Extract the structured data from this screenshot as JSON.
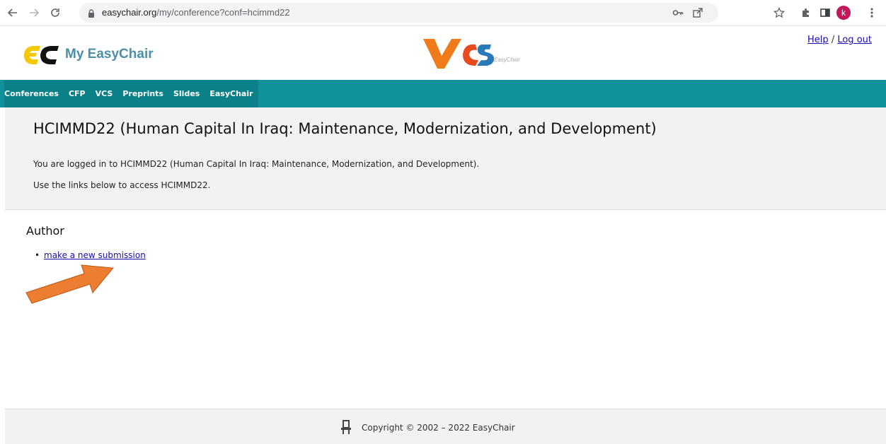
{
  "browser": {
    "url_domain": "easychair.org",
    "url_path": "/my/conference?conf=hcimmd22",
    "profile_initial": "k"
  },
  "header": {
    "brand": "My EasyChair",
    "vcs_tagline": "EasyChair",
    "help_label": "Help",
    "separator": "/",
    "logout_label": "Log out"
  },
  "menu": {
    "items": [
      {
        "label": "Conferences"
      },
      {
        "label": "CFP"
      },
      {
        "label": "VCS"
      },
      {
        "label": "Preprints"
      },
      {
        "label": "Slides"
      },
      {
        "label": "EasyChair"
      }
    ]
  },
  "intro": {
    "title": "HCIMMD22 (Human Capital In Iraq: Maintenance, Modernization, and Development)",
    "line1": "You are logged in to HCIMMD22 (Human Capital In Iraq: Maintenance, Modernization, and Development).",
    "line2": "Use the links below to access HCIMMD22."
  },
  "author": {
    "heading": "Author",
    "links": [
      {
        "label": "make a new submission"
      }
    ]
  },
  "footer": {
    "copyright": "Copyright © 2002 – 2022 EasyChair"
  },
  "colors": {
    "menu_bg": "#10929b",
    "brand": "#4c8fa8",
    "link": "#1a0dab",
    "arrow": "#ed7d31"
  },
  "icons": [
    "back-arrow-icon",
    "forward-arrow-icon",
    "reload-icon",
    "lock-icon",
    "key-icon",
    "share-icon",
    "star-icon",
    "puzzle-icon",
    "sidepanel-icon",
    "menu-dots-icon",
    "easychair-logo",
    "vcs-logo",
    "chair-icon",
    "annotation-arrow"
  ]
}
